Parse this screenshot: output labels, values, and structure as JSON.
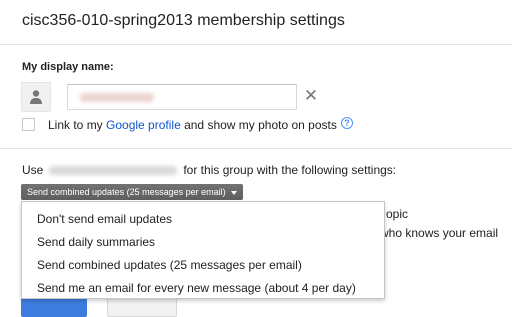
{
  "page": {
    "title": "cisc356-010-spring2013 membership settings"
  },
  "display_name": {
    "label": "My display name:",
    "input_value": "",
    "clear_symbol": "✕",
    "avatar_icon": "person-icon"
  },
  "profile": {
    "prefix": "Link to my ",
    "link": "Google profile",
    "suffix": " and show my photo on posts",
    "help_symbol": "?"
  },
  "email_settings": {
    "use_prefix": "Use",
    "use_suffix": "for this group with the following settings:",
    "dropdown_label": "Send combined updates (25 messages per email)",
    "background_text_1": "opic",
    "background_text_2": "who knows your email"
  },
  "menu": {
    "items": [
      "Don't send email updates",
      "Send daily summaries",
      "Send combined updates (25 messages per email)",
      "Send me an email for every new message (about 4 per day)"
    ]
  },
  "colors": {
    "link": "#1155cc",
    "dropdown_bg": "#666666",
    "primary_button": "#3e7de0"
  }
}
